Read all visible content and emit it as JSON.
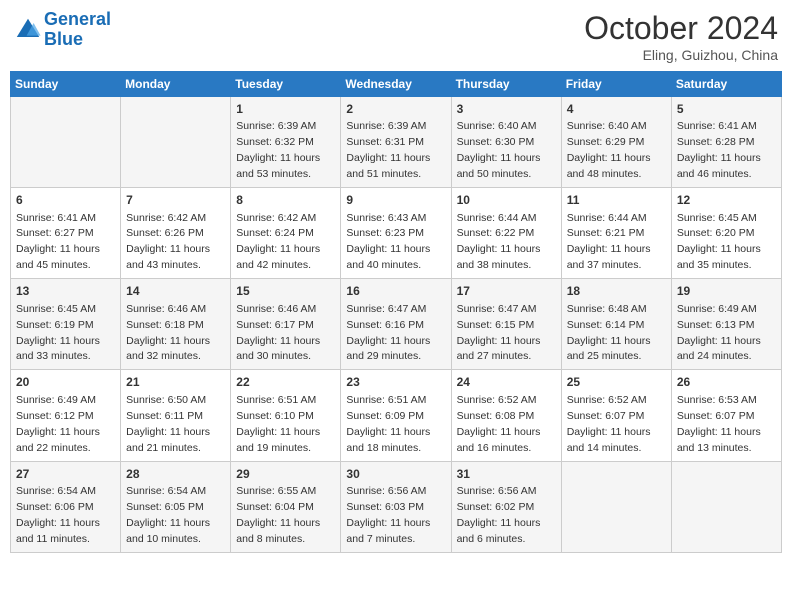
{
  "header": {
    "logo_general": "General",
    "logo_blue": "Blue",
    "month_year": "October 2024",
    "location": "Eling, Guizhou, China"
  },
  "days_of_week": [
    "Sunday",
    "Monday",
    "Tuesday",
    "Wednesday",
    "Thursday",
    "Friday",
    "Saturday"
  ],
  "weeks": [
    [
      null,
      null,
      {
        "day": "1",
        "sunrise": "Sunrise: 6:39 AM",
        "sunset": "Sunset: 6:32 PM",
        "daylight": "Daylight: 11 hours and 53 minutes."
      },
      {
        "day": "2",
        "sunrise": "Sunrise: 6:39 AM",
        "sunset": "Sunset: 6:31 PM",
        "daylight": "Daylight: 11 hours and 51 minutes."
      },
      {
        "day": "3",
        "sunrise": "Sunrise: 6:40 AM",
        "sunset": "Sunset: 6:30 PM",
        "daylight": "Daylight: 11 hours and 50 minutes."
      },
      {
        "day": "4",
        "sunrise": "Sunrise: 6:40 AM",
        "sunset": "Sunset: 6:29 PM",
        "daylight": "Daylight: 11 hours and 48 minutes."
      },
      {
        "day": "5",
        "sunrise": "Sunrise: 6:41 AM",
        "sunset": "Sunset: 6:28 PM",
        "daylight": "Daylight: 11 hours and 46 minutes."
      }
    ],
    [
      {
        "day": "6",
        "sunrise": "Sunrise: 6:41 AM",
        "sunset": "Sunset: 6:27 PM",
        "daylight": "Daylight: 11 hours and 45 minutes."
      },
      {
        "day": "7",
        "sunrise": "Sunrise: 6:42 AM",
        "sunset": "Sunset: 6:26 PM",
        "daylight": "Daylight: 11 hours and 43 minutes."
      },
      {
        "day": "8",
        "sunrise": "Sunrise: 6:42 AM",
        "sunset": "Sunset: 6:24 PM",
        "daylight": "Daylight: 11 hours and 42 minutes."
      },
      {
        "day": "9",
        "sunrise": "Sunrise: 6:43 AM",
        "sunset": "Sunset: 6:23 PM",
        "daylight": "Daylight: 11 hours and 40 minutes."
      },
      {
        "day": "10",
        "sunrise": "Sunrise: 6:44 AM",
        "sunset": "Sunset: 6:22 PM",
        "daylight": "Daylight: 11 hours and 38 minutes."
      },
      {
        "day": "11",
        "sunrise": "Sunrise: 6:44 AM",
        "sunset": "Sunset: 6:21 PM",
        "daylight": "Daylight: 11 hours and 37 minutes."
      },
      {
        "day": "12",
        "sunrise": "Sunrise: 6:45 AM",
        "sunset": "Sunset: 6:20 PM",
        "daylight": "Daylight: 11 hours and 35 minutes."
      }
    ],
    [
      {
        "day": "13",
        "sunrise": "Sunrise: 6:45 AM",
        "sunset": "Sunset: 6:19 PM",
        "daylight": "Daylight: 11 hours and 33 minutes."
      },
      {
        "day": "14",
        "sunrise": "Sunrise: 6:46 AM",
        "sunset": "Sunset: 6:18 PM",
        "daylight": "Daylight: 11 hours and 32 minutes."
      },
      {
        "day": "15",
        "sunrise": "Sunrise: 6:46 AM",
        "sunset": "Sunset: 6:17 PM",
        "daylight": "Daylight: 11 hours and 30 minutes."
      },
      {
        "day": "16",
        "sunrise": "Sunrise: 6:47 AM",
        "sunset": "Sunset: 6:16 PM",
        "daylight": "Daylight: 11 hours and 29 minutes."
      },
      {
        "day": "17",
        "sunrise": "Sunrise: 6:47 AM",
        "sunset": "Sunset: 6:15 PM",
        "daylight": "Daylight: 11 hours and 27 minutes."
      },
      {
        "day": "18",
        "sunrise": "Sunrise: 6:48 AM",
        "sunset": "Sunset: 6:14 PM",
        "daylight": "Daylight: 11 hours and 25 minutes."
      },
      {
        "day": "19",
        "sunrise": "Sunrise: 6:49 AM",
        "sunset": "Sunset: 6:13 PM",
        "daylight": "Daylight: 11 hours and 24 minutes."
      }
    ],
    [
      {
        "day": "20",
        "sunrise": "Sunrise: 6:49 AM",
        "sunset": "Sunset: 6:12 PM",
        "daylight": "Daylight: 11 hours and 22 minutes."
      },
      {
        "day": "21",
        "sunrise": "Sunrise: 6:50 AM",
        "sunset": "Sunset: 6:11 PM",
        "daylight": "Daylight: 11 hours and 21 minutes."
      },
      {
        "day": "22",
        "sunrise": "Sunrise: 6:51 AM",
        "sunset": "Sunset: 6:10 PM",
        "daylight": "Daylight: 11 hours and 19 minutes."
      },
      {
        "day": "23",
        "sunrise": "Sunrise: 6:51 AM",
        "sunset": "Sunset: 6:09 PM",
        "daylight": "Daylight: 11 hours and 18 minutes."
      },
      {
        "day": "24",
        "sunrise": "Sunrise: 6:52 AM",
        "sunset": "Sunset: 6:08 PM",
        "daylight": "Daylight: 11 hours and 16 minutes."
      },
      {
        "day": "25",
        "sunrise": "Sunrise: 6:52 AM",
        "sunset": "Sunset: 6:07 PM",
        "daylight": "Daylight: 11 hours and 14 minutes."
      },
      {
        "day": "26",
        "sunrise": "Sunrise: 6:53 AM",
        "sunset": "Sunset: 6:07 PM",
        "daylight": "Daylight: 11 hours and 13 minutes."
      }
    ],
    [
      {
        "day": "27",
        "sunrise": "Sunrise: 6:54 AM",
        "sunset": "Sunset: 6:06 PM",
        "daylight": "Daylight: 11 hours and 11 minutes."
      },
      {
        "day": "28",
        "sunrise": "Sunrise: 6:54 AM",
        "sunset": "Sunset: 6:05 PM",
        "daylight": "Daylight: 11 hours and 10 minutes."
      },
      {
        "day": "29",
        "sunrise": "Sunrise: 6:55 AM",
        "sunset": "Sunset: 6:04 PM",
        "daylight": "Daylight: 11 hours and 8 minutes."
      },
      {
        "day": "30",
        "sunrise": "Sunrise: 6:56 AM",
        "sunset": "Sunset: 6:03 PM",
        "daylight": "Daylight: 11 hours and 7 minutes."
      },
      {
        "day": "31",
        "sunrise": "Sunrise: 6:56 AM",
        "sunset": "Sunset: 6:02 PM",
        "daylight": "Daylight: 11 hours and 6 minutes."
      },
      null,
      null
    ]
  ]
}
